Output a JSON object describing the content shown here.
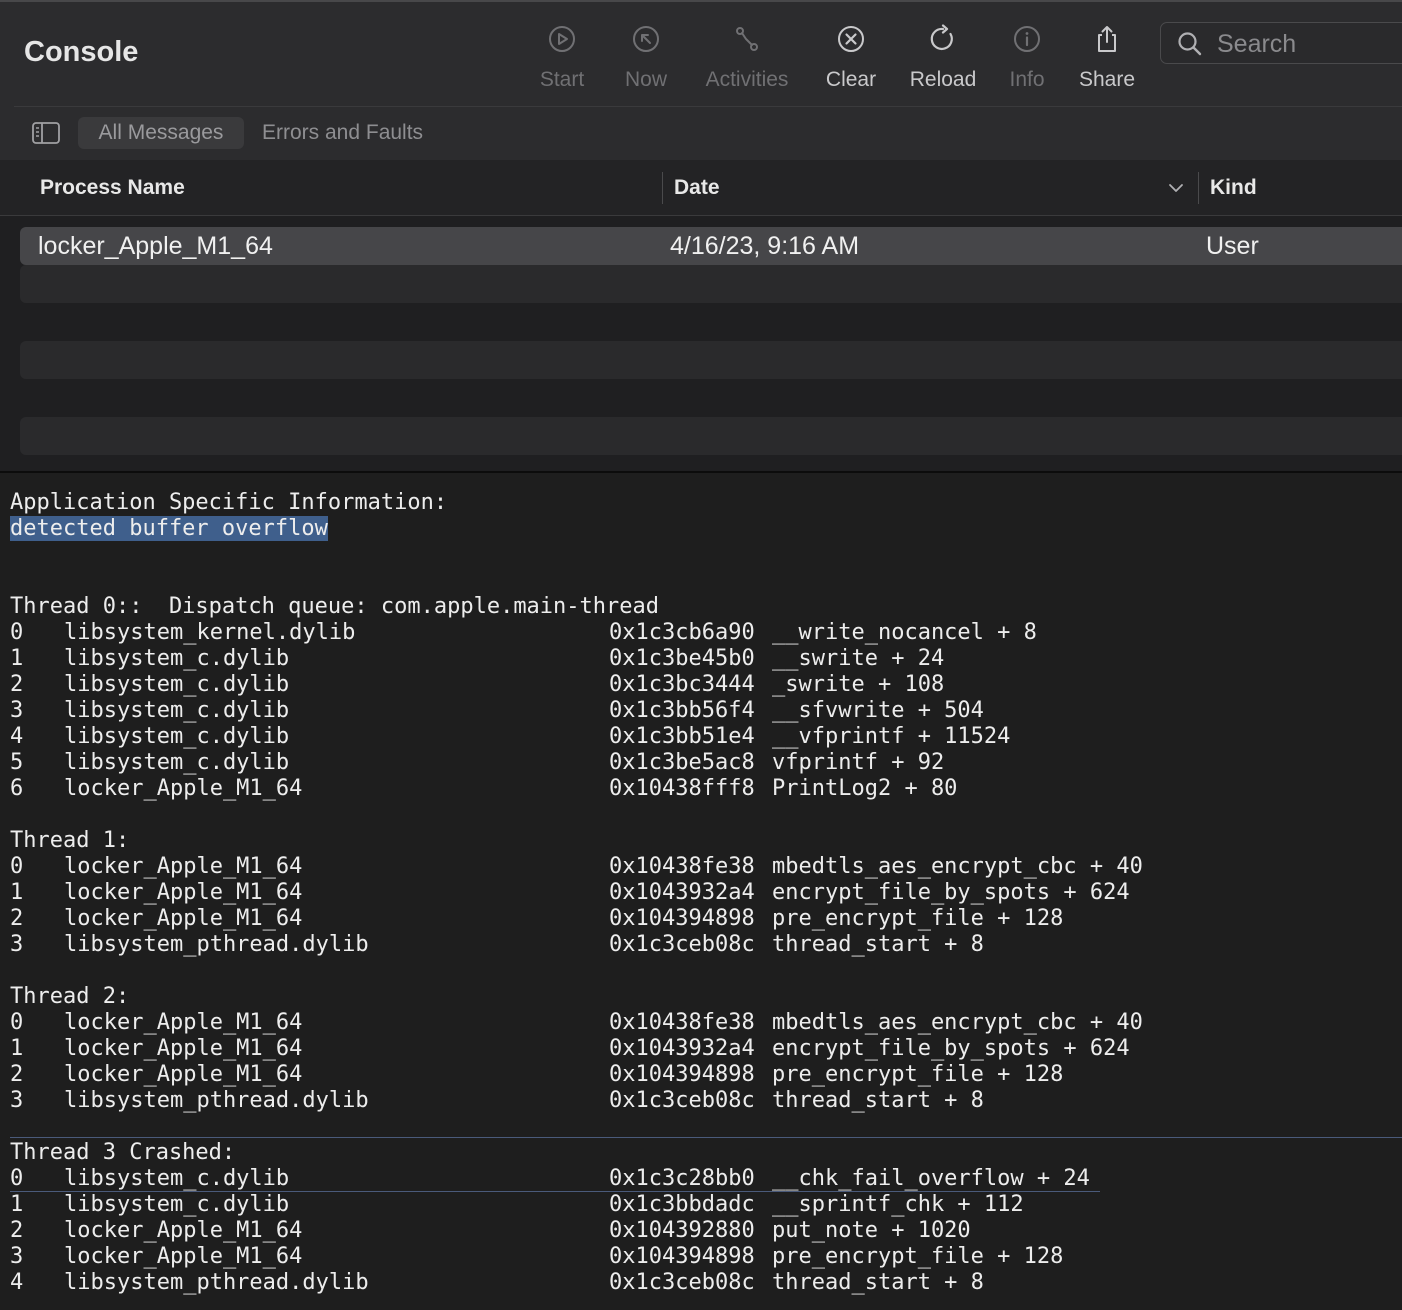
{
  "app": {
    "title": "Console"
  },
  "toolbar": {
    "start": {
      "label": "Start",
      "icon": "play-circle-icon"
    },
    "now": {
      "label": "Now",
      "icon": "arrow-up-left-circle-icon"
    },
    "activities": {
      "label": "Activities",
      "icon": "activities-icon"
    },
    "clear": {
      "label": "Clear",
      "icon": "x-circle-icon"
    },
    "reload": {
      "label": "Reload",
      "icon": "reload-icon"
    },
    "info": {
      "label": "Info",
      "icon": "info-circle-icon"
    },
    "share": {
      "label": "Share",
      "icon": "share-icon"
    },
    "search_placeholder": "Search"
  },
  "filters": {
    "all": "All Messages",
    "errors": "Errors and Faults"
  },
  "table": {
    "columns": {
      "process": "Process Name",
      "date": "Date",
      "kind": "Kind"
    },
    "rows": [
      {
        "process": "locker_Apple_M1_64",
        "date": "4/16/23, 9:16 AM",
        "kind": "User"
      }
    ]
  },
  "log": {
    "app_info_header": "Application Specific Information:",
    "app_info_value": "detected buffer overflow",
    "threads": [
      {
        "title": "Thread 0::  Dispatch queue: com.apple.main-thread",
        "frames": [
          {
            "n": "0",
            "lib": "libsystem_kernel.dylib",
            "addr": "0x1c3cb6a90",
            "sym": "__write_nocancel + 8"
          },
          {
            "n": "1",
            "lib": "libsystem_c.dylib",
            "addr": "0x1c3be45b0",
            "sym": "__swrite + 24"
          },
          {
            "n": "2",
            "lib": "libsystem_c.dylib",
            "addr": "0x1c3bc3444",
            "sym": "_swrite + 108"
          },
          {
            "n": "3",
            "lib": "libsystem_c.dylib",
            "addr": "0x1c3bb56f4",
            "sym": "__sfvwrite + 504"
          },
          {
            "n": "4",
            "lib": "libsystem_c.dylib",
            "addr": "0x1c3bb51e4",
            "sym": "__vfprintf + 11524"
          },
          {
            "n": "5",
            "lib": "libsystem_c.dylib",
            "addr": "0x1c3be5ac8",
            "sym": "vfprintf + 92"
          },
          {
            "n": "6",
            "lib": "locker_Apple_M1_64",
            "addr": "0x10438fff8",
            "sym": "PrintLog2 + 80"
          }
        ]
      },
      {
        "title": "Thread 1:",
        "frames": [
          {
            "n": "0",
            "lib": "locker_Apple_M1_64",
            "addr": "0x10438fe38",
            "sym": "mbedtls_aes_encrypt_cbc + 40"
          },
          {
            "n": "1",
            "lib": "locker_Apple_M1_64",
            "addr": "0x1043932a4",
            "sym": "encrypt_file_by_spots + 624"
          },
          {
            "n": "2",
            "lib": "locker_Apple_M1_64",
            "addr": "0x104394898",
            "sym": "pre_encrypt_file + 128"
          },
          {
            "n": "3",
            "lib": "libsystem_pthread.dylib",
            "addr": "0x1c3ceb08c",
            "sym": "thread_start + 8"
          }
        ]
      },
      {
        "title": "Thread 2:",
        "frames": [
          {
            "n": "0",
            "lib": "locker_Apple_M1_64",
            "addr": "0x10438fe38",
            "sym": "mbedtls_aes_encrypt_cbc + 40"
          },
          {
            "n": "1",
            "lib": "locker_Apple_M1_64",
            "addr": "0x1043932a4",
            "sym": "encrypt_file_by_spots + 624"
          },
          {
            "n": "2",
            "lib": "locker_Apple_M1_64",
            "addr": "0x104394898",
            "sym": "pre_encrypt_file + 128"
          },
          {
            "n": "3",
            "lib": "libsystem_pthread.dylib",
            "addr": "0x1c3ceb08c",
            "sym": "thread_start + 8"
          }
        ]
      },
      {
        "title": "Thread 3 Crashed:",
        "frames": [
          {
            "n": "0",
            "lib": "libsystem_c.dylib",
            "addr": "0x1c3c28bb0",
            "sym": "__chk_fail_overflow + 24"
          },
          {
            "n": "1",
            "lib": "libsystem_c.dylib",
            "addr": "0x1c3bbdadc",
            "sym": "__sprintf_chk + 112"
          },
          {
            "n": "2",
            "lib": "locker_Apple_M1_64",
            "addr": "0x104392880",
            "sym": "put_note + 1020"
          },
          {
            "n": "3",
            "lib": "locker_Apple_M1_64",
            "addr": "0x104394898",
            "sym": "pre_encrypt_file + 128"
          },
          {
            "n": "4",
            "lib": "libsystem_pthread.dylib",
            "addr": "0x1c3ceb08c",
            "sym": "thread_start + 8"
          }
        ]
      }
    ]
  }
}
